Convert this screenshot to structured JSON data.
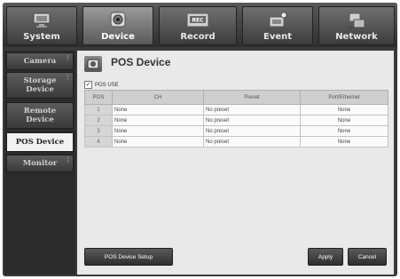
{
  "tabs": [
    {
      "label": "System",
      "icon": "monitor-icon",
      "active": false
    },
    {
      "label": "Device",
      "icon": "camera-icon",
      "active": true
    },
    {
      "label": "Record",
      "icon": "rec-icon",
      "active": false
    },
    {
      "label": "Event",
      "icon": "event-icon",
      "active": false
    },
    {
      "label": "Network",
      "icon": "network-icon",
      "active": false
    }
  ],
  "sidebar": {
    "items": [
      {
        "label": "Camera",
        "active": false
      },
      {
        "label": "Storage Device",
        "active": false
      },
      {
        "label": "Remote Device",
        "active": false
      },
      {
        "label": "POS Device",
        "active": true
      },
      {
        "label": "Monitor",
        "active": false
      }
    ]
  },
  "page": {
    "title": "POS Device",
    "pos_use_label": "POS USE",
    "pos_use_checked": true
  },
  "table": {
    "headers": [
      "POS",
      "CH",
      "Preset",
      "Port/Ethernet"
    ],
    "rows": [
      {
        "pos": "1",
        "ch": "None",
        "preset": "No preset",
        "port": "None"
      },
      {
        "pos": "2",
        "ch": "None",
        "preset": "No preset",
        "port": "None"
      },
      {
        "pos": "3",
        "ch": "None",
        "preset": "No preset",
        "port": "None"
      },
      {
        "pos": "4",
        "ch": "None",
        "preset": "No preset",
        "port": "None"
      }
    ]
  },
  "buttons": {
    "setup": "POS Device Setup",
    "apply": "Apply",
    "cancel": "Cancel"
  }
}
